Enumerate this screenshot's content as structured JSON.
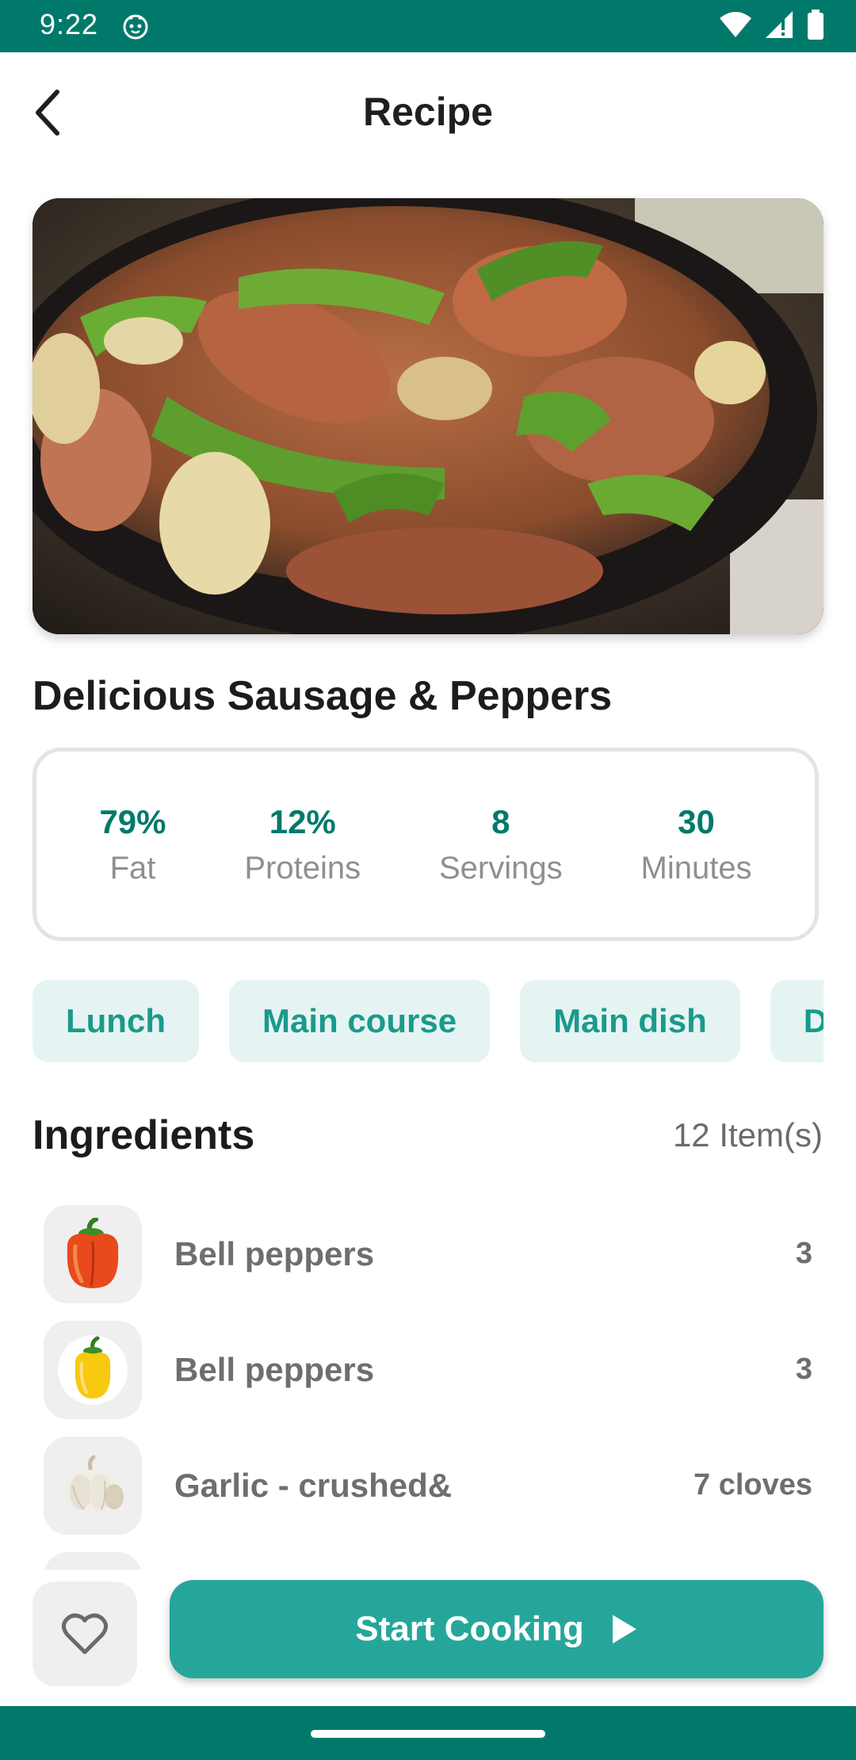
{
  "status_bar": {
    "time": "9:22",
    "icons": [
      "app-notification-icon",
      "wifi-icon",
      "signal-icon",
      "battery-icon"
    ]
  },
  "header": {
    "title": "Recipe",
    "back_icon": "back-arrow-icon"
  },
  "recipe": {
    "title": "Delicious Sausage & Peppers",
    "image": "sausage-and-peppers-photo"
  },
  "stats": [
    {
      "value": "79%",
      "label": "Fat"
    },
    {
      "value": "12%",
      "label": "Proteins"
    },
    {
      "value": "8",
      "label": "Servings"
    },
    {
      "value": "30",
      "label": "Minutes"
    }
  ],
  "tags": [
    "Lunch",
    "Main course",
    "Main dish",
    "Dinner"
  ],
  "ingredients": {
    "title": "Ingredients",
    "count": "12 Item(s)",
    "items": [
      {
        "name": "Bell peppers",
        "qty": "3",
        "icon": "red-bell-pepper-icon"
      },
      {
        "name": "Bell peppers",
        "qty": "3",
        "icon": "yellow-bell-pepper-icon"
      },
      {
        "name": "Garlic - crushed&",
        "qty": "7 cloves",
        "icon": "garlic-icon"
      }
    ]
  },
  "actions": {
    "favorite_icon": "heart-icon",
    "start_label": "Start Cooking",
    "start_icon": "play-icon"
  },
  "colors": {
    "primary": "#00796b",
    "accent": "#26a69a",
    "tag_bg": "#e5f4f3",
    "tag_text": "#1a9a8c"
  }
}
